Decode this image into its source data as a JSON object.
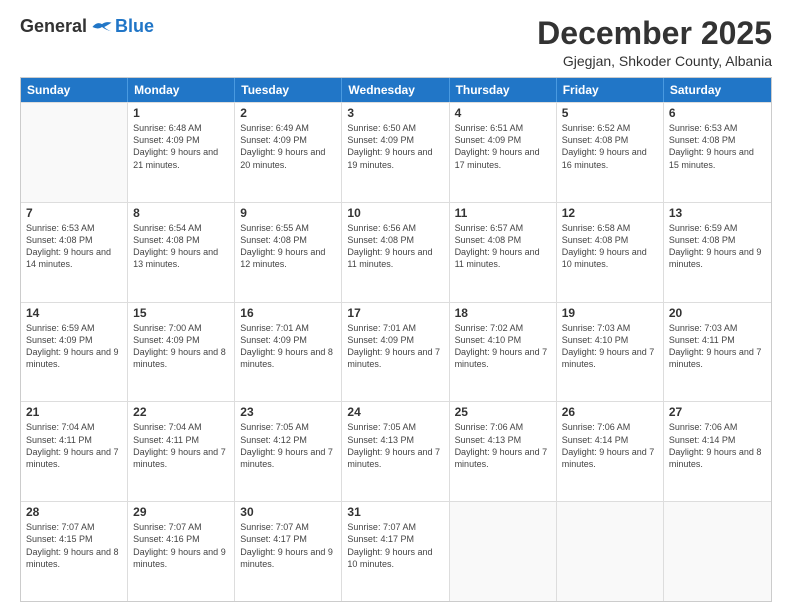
{
  "logo": {
    "general": "General",
    "blue": "Blue"
  },
  "title": "December 2025",
  "location": "Gjegjan, Shkoder County, Albania",
  "days_of_week": [
    "Sunday",
    "Monday",
    "Tuesday",
    "Wednesday",
    "Thursday",
    "Friday",
    "Saturday"
  ],
  "weeks": [
    [
      {
        "day": "",
        "sunrise": "",
        "sunset": "",
        "daylight": ""
      },
      {
        "day": "1",
        "sunrise": "Sunrise: 6:48 AM",
        "sunset": "Sunset: 4:09 PM",
        "daylight": "Daylight: 9 hours and 21 minutes."
      },
      {
        "day": "2",
        "sunrise": "Sunrise: 6:49 AM",
        "sunset": "Sunset: 4:09 PM",
        "daylight": "Daylight: 9 hours and 20 minutes."
      },
      {
        "day": "3",
        "sunrise": "Sunrise: 6:50 AM",
        "sunset": "Sunset: 4:09 PM",
        "daylight": "Daylight: 9 hours and 19 minutes."
      },
      {
        "day": "4",
        "sunrise": "Sunrise: 6:51 AM",
        "sunset": "Sunset: 4:09 PM",
        "daylight": "Daylight: 9 hours and 17 minutes."
      },
      {
        "day": "5",
        "sunrise": "Sunrise: 6:52 AM",
        "sunset": "Sunset: 4:08 PM",
        "daylight": "Daylight: 9 hours and 16 minutes."
      },
      {
        "day": "6",
        "sunrise": "Sunrise: 6:53 AM",
        "sunset": "Sunset: 4:08 PM",
        "daylight": "Daylight: 9 hours and 15 minutes."
      }
    ],
    [
      {
        "day": "7",
        "sunrise": "Sunrise: 6:53 AM",
        "sunset": "Sunset: 4:08 PM",
        "daylight": "Daylight: 9 hours and 14 minutes."
      },
      {
        "day": "8",
        "sunrise": "Sunrise: 6:54 AM",
        "sunset": "Sunset: 4:08 PM",
        "daylight": "Daylight: 9 hours and 13 minutes."
      },
      {
        "day": "9",
        "sunrise": "Sunrise: 6:55 AM",
        "sunset": "Sunset: 4:08 PM",
        "daylight": "Daylight: 9 hours and 12 minutes."
      },
      {
        "day": "10",
        "sunrise": "Sunrise: 6:56 AM",
        "sunset": "Sunset: 4:08 PM",
        "daylight": "Daylight: 9 hours and 11 minutes."
      },
      {
        "day": "11",
        "sunrise": "Sunrise: 6:57 AM",
        "sunset": "Sunset: 4:08 PM",
        "daylight": "Daylight: 9 hours and 11 minutes."
      },
      {
        "day": "12",
        "sunrise": "Sunrise: 6:58 AM",
        "sunset": "Sunset: 4:08 PM",
        "daylight": "Daylight: 9 hours and 10 minutes."
      },
      {
        "day": "13",
        "sunrise": "Sunrise: 6:59 AM",
        "sunset": "Sunset: 4:08 PM",
        "daylight": "Daylight: 9 hours and 9 minutes."
      }
    ],
    [
      {
        "day": "14",
        "sunrise": "Sunrise: 6:59 AM",
        "sunset": "Sunset: 4:09 PM",
        "daylight": "Daylight: 9 hours and 9 minutes."
      },
      {
        "day": "15",
        "sunrise": "Sunrise: 7:00 AM",
        "sunset": "Sunset: 4:09 PM",
        "daylight": "Daylight: 9 hours and 8 minutes."
      },
      {
        "day": "16",
        "sunrise": "Sunrise: 7:01 AM",
        "sunset": "Sunset: 4:09 PM",
        "daylight": "Daylight: 9 hours and 8 minutes."
      },
      {
        "day": "17",
        "sunrise": "Sunrise: 7:01 AM",
        "sunset": "Sunset: 4:09 PM",
        "daylight": "Daylight: 9 hours and 7 minutes."
      },
      {
        "day": "18",
        "sunrise": "Sunrise: 7:02 AM",
        "sunset": "Sunset: 4:10 PM",
        "daylight": "Daylight: 9 hours and 7 minutes."
      },
      {
        "day": "19",
        "sunrise": "Sunrise: 7:03 AM",
        "sunset": "Sunset: 4:10 PM",
        "daylight": "Daylight: 9 hours and 7 minutes."
      },
      {
        "day": "20",
        "sunrise": "Sunrise: 7:03 AM",
        "sunset": "Sunset: 4:11 PM",
        "daylight": "Daylight: 9 hours and 7 minutes."
      }
    ],
    [
      {
        "day": "21",
        "sunrise": "Sunrise: 7:04 AM",
        "sunset": "Sunset: 4:11 PM",
        "daylight": "Daylight: 9 hours and 7 minutes."
      },
      {
        "day": "22",
        "sunrise": "Sunrise: 7:04 AM",
        "sunset": "Sunset: 4:11 PM",
        "daylight": "Daylight: 9 hours and 7 minutes."
      },
      {
        "day": "23",
        "sunrise": "Sunrise: 7:05 AM",
        "sunset": "Sunset: 4:12 PM",
        "daylight": "Daylight: 9 hours and 7 minutes."
      },
      {
        "day": "24",
        "sunrise": "Sunrise: 7:05 AM",
        "sunset": "Sunset: 4:13 PM",
        "daylight": "Daylight: 9 hours and 7 minutes."
      },
      {
        "day": "25",
        "sunrise": "Sunrise: 7:06 AM",
        "sunset": "Sunset: 4:13 PM",
        "daylight": "Daylight: 9 hours and 7 minutes."
      },
      {
        "day": "26",
        "sunrise": "Sunrise: 7:06 AM",
        "sunset": "Sunset: 4:14 PM",
        "daylight": "Daylight: 9 hours and 7 minutes."
      },
      {
        "day": "27",
        "sunrise": "Sunrise: 7:06 AM",
        "sunset": "Sunset: 4:14 PM",
        "daylight": "Daylight: 9 hours and 8 minutes."
      }
    ],
    [
      {
        "day": "28",
        "sunrise": "Sunrise: 7:07 AM",
        "sunset": "Sunset: 4:15 PM",
        "daylight": "Daylight: 9 hours and 8 minutes."
      },
      {
        "day": "29",
        "sunrise": "Sunrise: 7:07 AM",
        "sunset": "Sunset: 4:16 PM",
        "daylight": "Daylight: 9 hours and 9 minutes."
      },
      {
        "day": "30",
        "sunrise": "Sunrise: 7:07 AM",
        "sunset": "Sunset: 4:17 PM",
        "daylight": "Daylight: 9 hours and 9 minutes."
      },
      {
        "day": "31",
        "sunrise": "Sunrise: 7:07 AM",
        "sunset": "Sunset: 4:17 PM",
        "daylight": "Daylight: 9 hours and 10 minutes."
      },
      {
        "day": "",
        "sunrise": "",
        "sunset": "",
        "daylight": ""
      },
      {
        "day": "",
        "sunrise": "",
        "sunset": "",
        "daylight": ""
      },
      {
        "day": "",
        "sunrise": "",
        "sunset": "",
        "daylight": ""
      }
    ]
  ]
}
